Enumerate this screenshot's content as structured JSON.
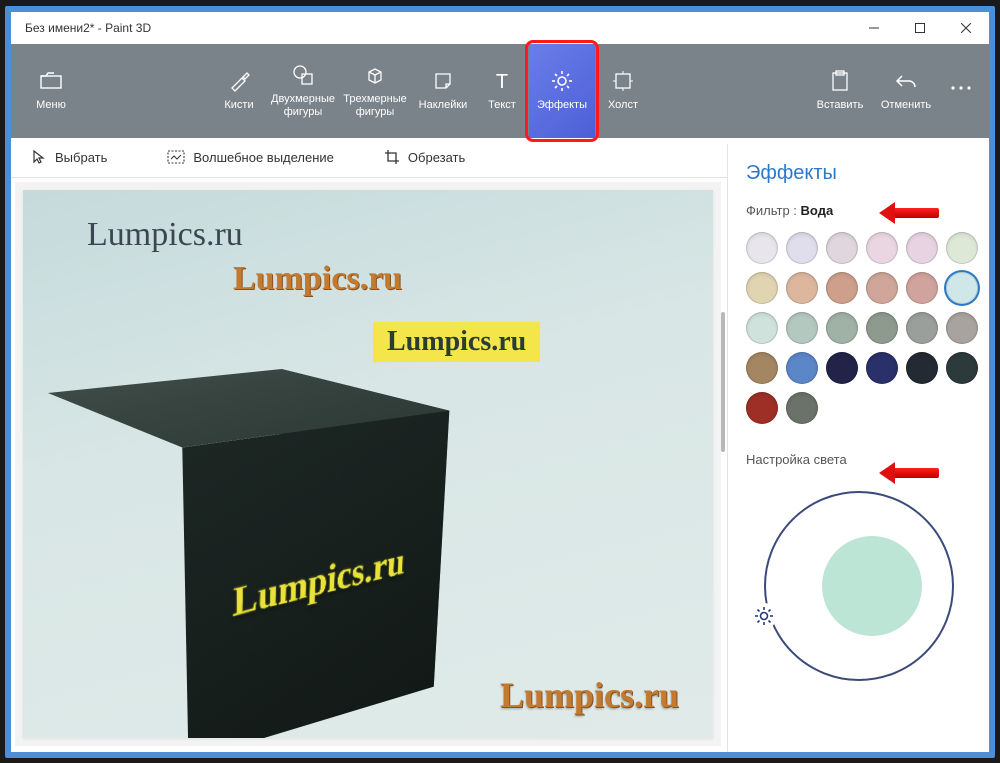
{
  "window": {
    "title": "Без имени2* - Paint 3D"
  },
  "ribbon": {
    "menu": "Меню",
    "brushes": "Кисти",
    "shapes2d": "Двухмерные фигуры",
    "shapes3d": "Трехмерные фигуры",
    "stickers": "Наклейки",
    "text": "Текст",
    "effects": "Эффекты",
    "canvas": "Холст",
    "paste": "Вставить",
    "undo": "Отменить"
  },
  "toolbar": {
    "select": "Выбрать",
    "magic_select": "Волшебное выделение",
    "crop": "Обрезать"
  },
  "panel": {
    "title": "Эффекты",
    "filter_label": "Фильтр :",
    "filter_value": "Вода",
    "light_label": "Настройка света"
  },
  "swatches": [
    "#e8e5ec",
    "#e0ddec",
    "#e0d6de",
    "#ead6e2",
    "#e7d3e2",
    "#dde8d7",
    "#e1d4b1",
    "#ddb79d",
    "#ce9f8a",
    "#d0a69a",
    "#d0a39c",
    "#cfe7e9",
    "#cfe2dc",
    "#b3c8be",
    "#9fb2a5",
    "#8f9a8f",
    "#9a9f9c",
    "#a8a39e",
    "#a58663",
    "#5b86c8",
    "#23234a",
    "#2a306a",
    "#242a33",
    "#2c3a3c",
    "#9e2f26",
    "#6b7269"
  ],
  "swatch_selected_index": 11,
  "canvas_text": {
    "wm1": "Lumpics.ru",
    "wm2": "Lumpics.ru",
    "wm3": "Lumpics.ru",
    "wm4": "Lumpics.ru",
    "cube": "Lumpics.ru"
  }
}
